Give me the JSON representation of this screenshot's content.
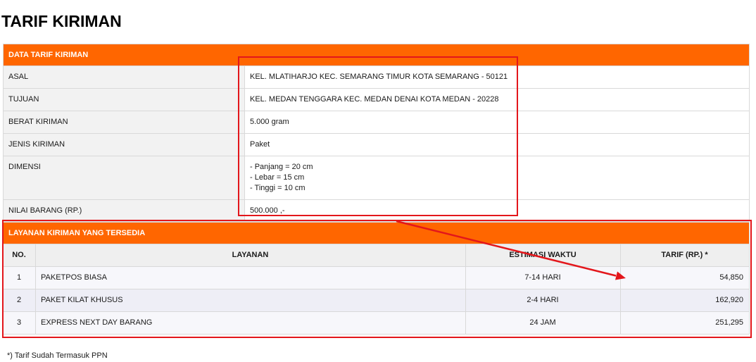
{
  "theme": {
    "accent": "#ff6600",
    "label_bg": "#f2f2f2",
    "column_header_bg": "#efefef",
    "row_odd_bg": "#f7f7fb",
    "row_even_bg": "#eeeef6",
    "border": "#d9d9d9",
    "annotation": "#e3161b"
  },
  "page": {
    "title": "TARIF KIRIMAN"
  },
  "data_table": {
    "heading": "DATA TARIF KIRIMAN",
    "rows": [
      {
        "label": "ASAL",
        "value": "KEL. MLATIHARJO KEC. SEMARANG TIMUR KOTA SEMARANG - 50121"
      },
      {
        "label": "TUJUAN",
        "value": "KEL. MEDAN TENGGARA KEC. MEDAN DENAI KOTA MEDAN - 20228"
      },
      {
        "label": "BERAT KIRIMAN",
        "value": "5.000 gram"
      },
      {
        "label": "JENIS KIRIMAN",
        "value": "Paket"
      },
      {
        "label": "DIMENSI",
        "lines": [
          "- Panjang = 20 cm",
          "- Lebar = 15 cm",
          "- Tinggi = 10 cm"
        ]
      },
      {
        "label": "NILAI BARANG (RP.)",
        "value": "500.000 ,-"
      }
    ]
  },
  "services_table": {
    "heading": "LAYANAN KIRIMAN YANG TERSEDIA",
    "columns": {
      "no": "NO.",
      "service": "LAYANAN",
      "eta": "ESTIMASI WAKTU",
      "rate": "TARIF (RP.) *"
    },
    "rows": [
      {
        "no": "1",
        "service": "PAKETPOS BIASA",
        "eta": "7-14 HARI",
        "rate": "54,850"
      },
      {
        "no": "2",
        "service": "PAKET KILAT KHUSUS",
        "eta": "2-4 HARI",
        "rate": "162,920"
      },
      {
        "no": "3",
        "service": "EXPRESS NEXT DAY BARANG",
        "eta": "24 JAM",
        "rate": "251,295"
      }
    ]
  },
  "footnote": "*) Tarif Sudah Termasuk PPN"
}
